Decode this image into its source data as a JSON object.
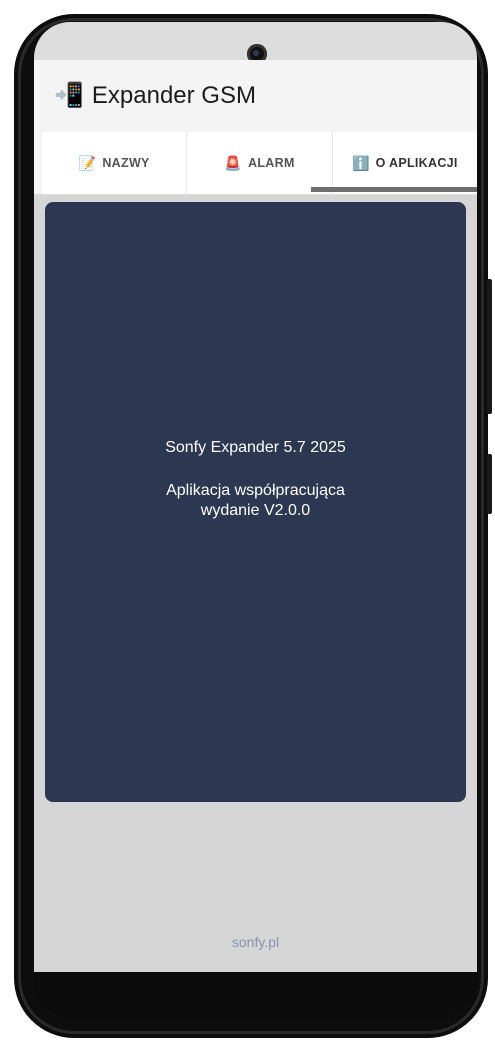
{
  "app": {
    "title": "Expander GSM",
    "icon": "mobile-arrow-icon"
  },
  "tabs": [
    {
      "label": "NAZWY",
      "icon": "memo-icon",
      "glyph": "📝"
    },
    {
      "label": "ALARM",
      "icon": "siren-icon",
      "glyph": "🚨"
    },
    {
      "label": "O APLIKACJI",
      "icon": "info-icon",
      "glyph": "ℹ️",
      "active": true
    }
  ],
  "card": {
    "line1": "Sonfy Expander 5.7 2025",
    "line2": "Aplikacja współpracująca",
    "line3": "wydanie V2.0.0"
  },
  "footer": {
    "link": "sonfy.pl"
  },
  "colors": {
    "card_bg": "#2c3752",
    "screen_bg": "#d6d6d6",
    "tab_indicator": "#6f6f6f",
    "footer_text": "#8a93a8"
  }
}
